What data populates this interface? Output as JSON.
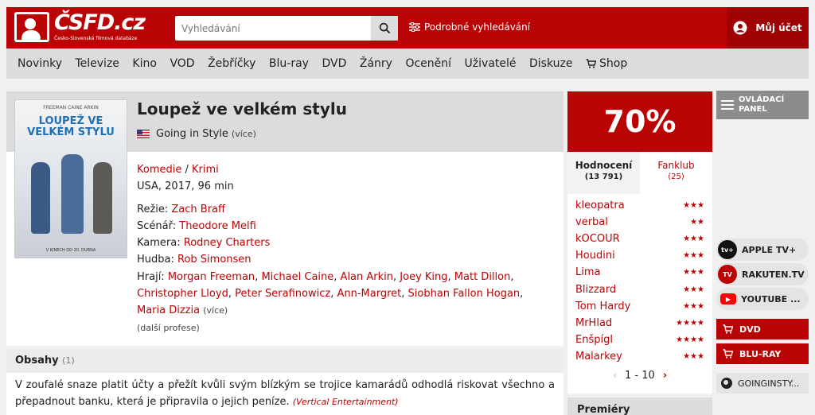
{
  "header": {
    "logo_text": "ČSFD.cz",
    "logo_subtitle": "Česko-Slovenská filmová databáze",
    "search_placeholder": "Vyhledávání",
    "advanced_search": "Podrobné vyhledávání",
    "account_label": "Můj účet",
    "brand_color": "#ba0305"
  },
  "nav": {
    "items": [
      "Novinky",
      "Televize",
      "Kino",
      "VOD",
      "Žebříčky",
      "Blu-ray",
      "DVD",
      "Žánry",
      "Ocenění",
      "Uživatelé",
      "Diskuze"
    ],
    "shop": "Shop"
  },
  "film": {
    "title": "Loupež ve velkém stylu",
    "original_title": "Going in Style",
    "more": "(více)",
    "genre1": "Komedie",
    "genre_sep": " / ",
    "genre2": "Krimi",
    "origin": "USA, 2017, 96 min",
    "director_label": "Režie:",
    "director": "Zach Braff",
    "writer_label": "Scénář:",
    "writer": "Theodore Melfi",
    "camera_label": "Kamera:",
    "camera": "Rodney Charters",
    "music_label": "Hudba:",
    "music": "Rob Simonsen",
    "cast_label": "Hrají:",
    "cast": [
      "Morgan Freeman",
      "Michael Caine",
      "Alan Arkin",
      "Joey King",
      "Matt Dillon",
      "Christopher Lloyd",
      "Peter Serafinowicz",
      "Ann-Margret",
      "Siobhan Fallon Hogan",
      "Maria Dizzia"
    ],
    "cast_more": "(více)",
    "more_professions": "(další profese)",
    "poster": {
      "title_line1": "LOUPEŽ VE VELKÉM STYLU",
      "names": "FREEMAN   CAINE   ARKIN",
      "release": "V KINECH OD 20. DUBNA"
    }
  },
  "content": {
    "heading": "Obsahy",
    "count": "(1)",
    "text": "V zoufalé snaze platit účty a přežít kvůli svým blízkým se trojice kamarádů odhodlá riskovat všechno a přepadnout banku, která je připravila o jejich peníze.",
    "source": "(Vertical Entertainment)"
  },
  "rating": {
    "percent": "70%",
    "tab_ratings": "Hodnocení",
    "tab_ratings_count": "(13 791)",
    "tab_fanclub": "Fanklub",
    "tab_fanclub_count": "(25)",
    "fans": [
      {
        "name": "kleopatra",
        "stars": "★★★"
      },
      {
        "name": "verbal",
        "stars": "★★"
      },
      {
        "name": "kOCOUR",
        "stars": "★★★"
      },
      {
        "name": "Houdini",
        "stars": "★★★"
      },
      {
        "name": "Lima",
        "stars": "★★★"
      },
      {
        "name": "Blizzard",
        "stars": "★★★"
      },
      {
        "name": "Tom Hardy",
        "stars": "★★★"
      },
      {
        "name": "MrHlad",
        "stars": "★★★★"
      },
      {
        "name": "Enšpígl",
        "stars": "★★★★"
      },
      {
        "name": "Malarkey",
        "stars": "★★★"
      }
    ],
    "pager": "1 - 10",
    "premiery": "Premiéry"
  },
  "sidebar": {
    "control_panel_line1": "OVLÁDACÍ",
    "control_panel_line2": "PANEL",
    "services": [
      {
        "label": "APPLE TV+",
        "icon": "apple-tv-icon",
        "icon_text": "tv+",
        "color": "#111111"
      },
      {
        "label": "RAKUTEN.TV",
        "icon": "rakuten-tv-icon",
        "icon_text": "TV",
        "color": "#bf0000"
      },
      {
        "label": "YOUTUBE ...",
        "icon": "youtube-icon",
        "icon_text": "▶",
        "color": "#ff0000"
      }
    ],
    "buy": [
      "DVD",
      "BLU-RAY"
    ],
    "site": "GOINGINSTY..."
  }
}
